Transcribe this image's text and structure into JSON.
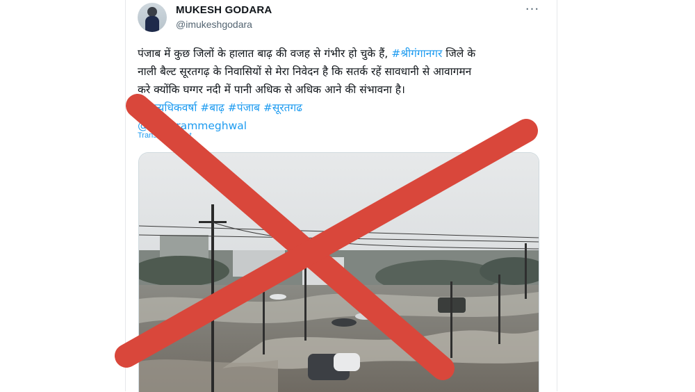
{
  "tweet": {
    "author_name": "MUKESH GODARA",
    "author_handle": "@imukeshgodara",
    "more_glyph": "···",
    "text_lines": [
      {
        "before": "पंजाब में कुछ जिलों के हालात बाढ़ की वजह से गंभीर हो चुके हैं, ",
        "hashtag": "#श्रीगंगानगर",
        "after": " जिले के"
      },
      {
        "text": "नाली बैल्ट सूरतगढ़ के निवासियों से मेरा निवेदन है कि सतर्क रहें सावधानी से आवागमन"
      },
      {
        "text": "करे क्योंकि घग्गर नदी में पानी अधिक से अधिक आने की संभावना है।"
      }
    ],
    "hashtags_line": "#अत्यधिकवर्षा #बाढ़ #पंजाब #सूरतगढ",
    "mention": "@arjunrammeghwal",
    "translate_label": "Translate Tweet"
  },
  "colors": {
    "link": "#1d9bf0",
    "cross": "#d9473b",
    "text": "#0f1419",
    "secondary": "#536471"
  },
  "icons": {
    "more": "more-horizontal-icon",
    "cross": "red-cross-mark"
  }
}
